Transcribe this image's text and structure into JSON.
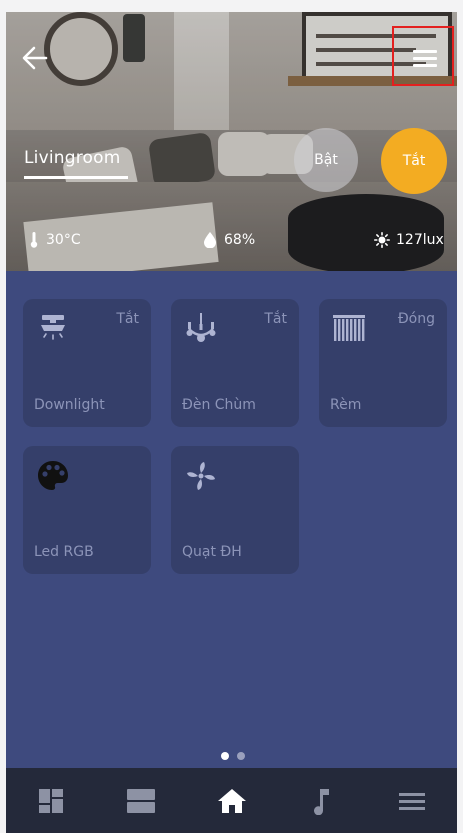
{
  "room": {
    "name": "Livingroom"
  },
  "power": {
    "on_label": "Bật",
    "off_label": "Tắt"
  },
  "stats": {
    "temperature": "30°C",
    "humidity": "68%",
    "light": "127lux"
  },
  "devices": [
    {
      "label": "Downlight",
      "state": "Tắt",
      "icon": "downlight-icon"
    },
    {
      "label": "Đèn Chùm",
      "state": "Tắt",
      "icon": "chandelier-icon"
    },
    {
      "label": "Rèm",
      "state": "Đóng",
      "icon": "curtain-icon"
    },
    {
      "label": "Led RGB",
      "state": "",
      "icon": "palette-icon"
    },
    {
      "label": "Quạt ĐH",
      "state": "",
      "icon": "fan-icon"
    }
  ],
  "pager": {
    "pages": 2,
    "active": 1
  },
  "nav": [
    {
      "name": "dashboard-icon"
    },
    {
      "name": "rooms-icon"
    },
    {
      "name": "home-icon",
      "active": true
    },
    {
      "name": "music-icon"
    },
    {
      "name": "menu-icon"
    }
  ],
  "colors": {
    "accent": "#f3ac22",
    "background": "#3e4a7e",
    "tile": "#353f6a",
    "navbar": "#24293a",
    "highlight": "#e3201f"
  }
}
